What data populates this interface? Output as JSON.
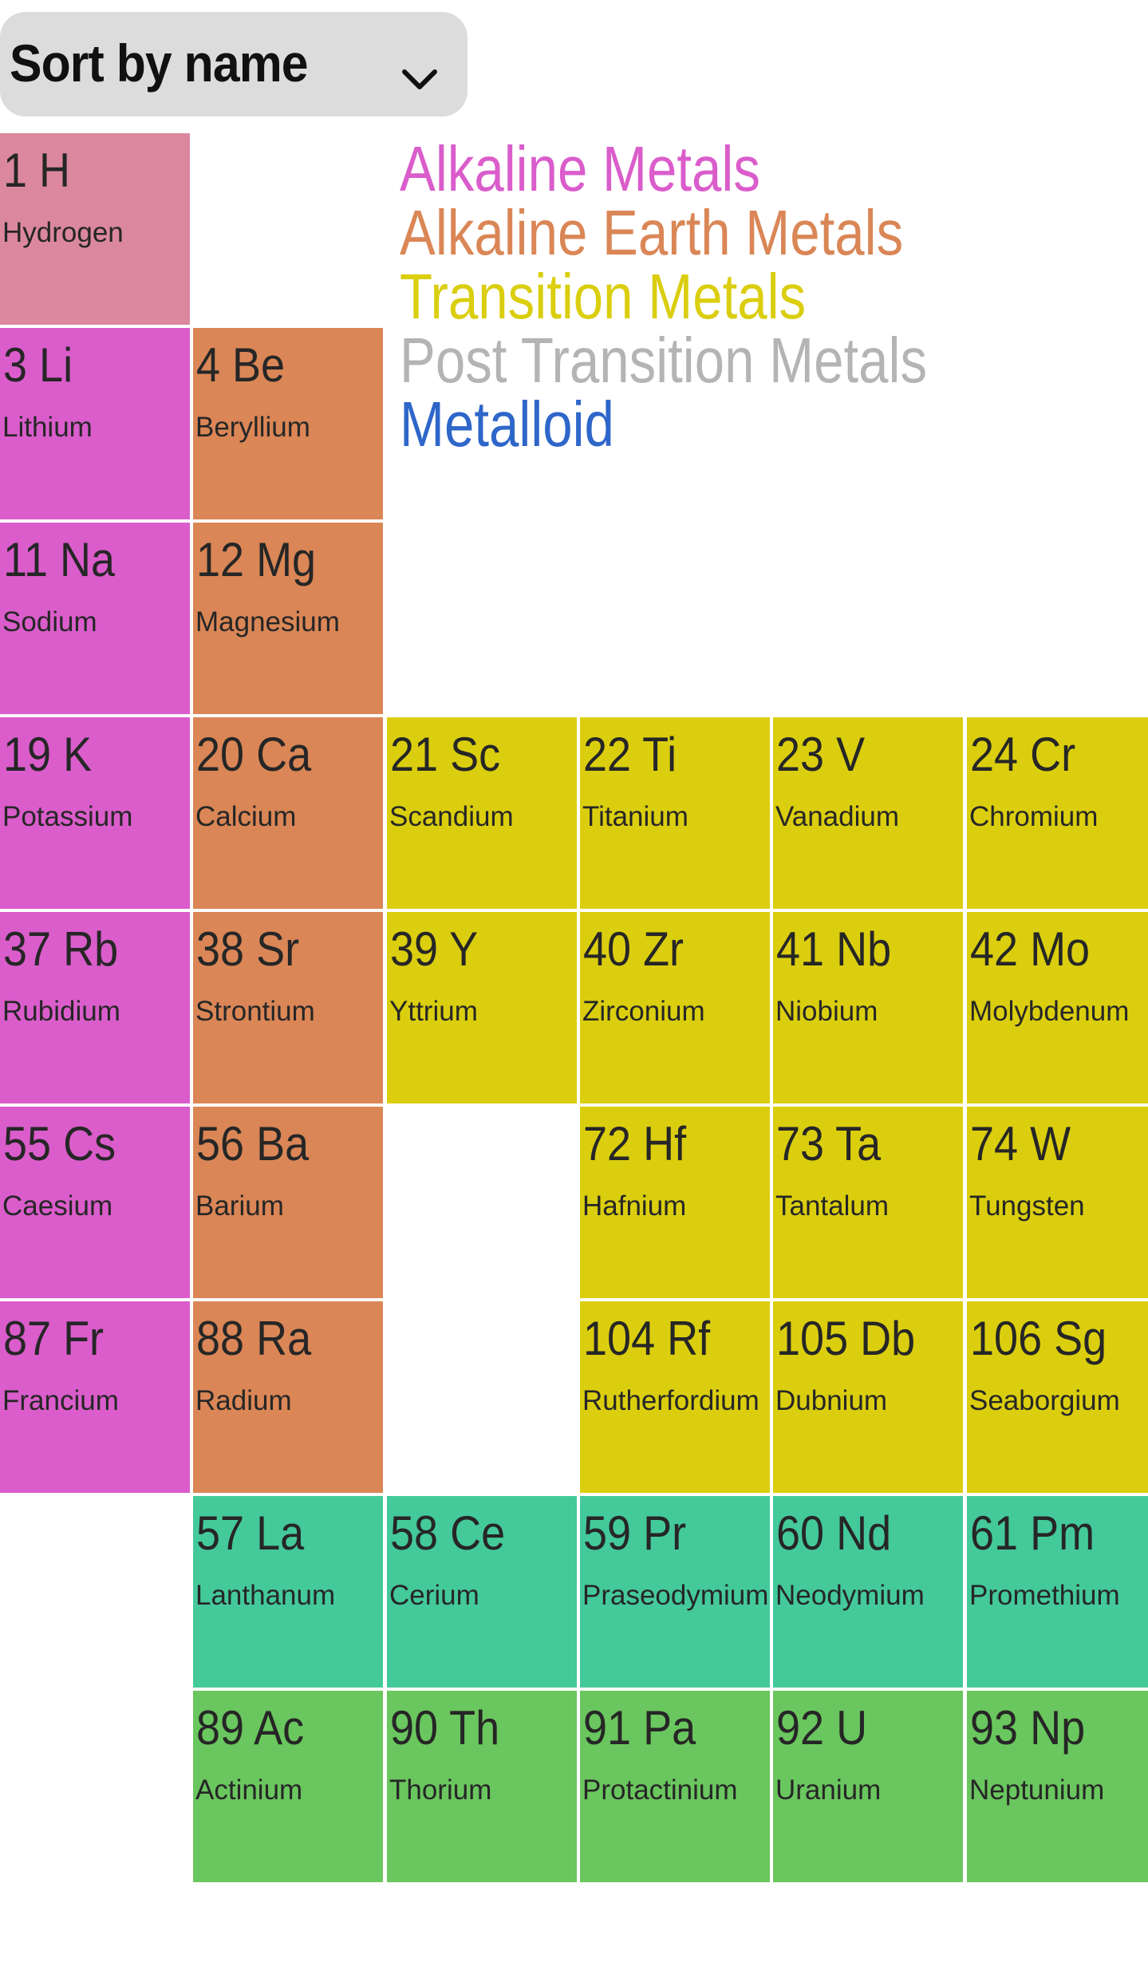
{
  "sort": {
    "label": "Sort by name",
    "icon": "chevron-down-icon"
  },
  "legend": [
    {
      "label": "Alkaline Metals",
      "color": "#DA5DCB"
    },
    {
      "label": "Alkaline Earth Metals",
      "color": "#DA8656"
    },
    {
      "label": "Transition Metals",
      "color": "#DACE0E"
    },
    {
      "label": "Post Transition Metals",
      "color": "#B4B4B4"
    },
    {
      "label": "Metalloid",
      "color": "#2E66C9"
    }
  ],
  "colors": {
    "hydrogen": "#DB889F",
    "alkali": "#DA5DCB",
    "alkaline_earth": "#DA8656",
    "transition": "#DBCE0E",
    "lanthanide": "#44C99A",
    "actinide": "#6AC65E"
  },
  "elements": [
    {
      "number": 1,
      "symbol": "H",
      "name": "Hydrogen",
      "category": "hydrogen",
      "row": 0,
      "col": 0
    },
    {
      "number": 3,
      "symbol": "Li",
      "name": "Lithium",
      "category": "alkali",
      "row": 1,
      "col": 0
    },
    {
      "number": 4,
      "symbol": "Be",
      "name": "Beryllium",
      "category": "alkaline_earth",
      "row": 1,
      "col": 1
    },
    {
      "number": 11,
      "symbol": "Na",
      "name": "Sodium",
      "category": "alkali",
      "row": 2,
      "col": 0
    },
    {
      "number": 12,
      "symbol": "Mg",
      "name": "Magnesium",
      "category": "alkaline_earth",
      "row": 2,
      "col": 1
    },
    {
      "number": 19,
      "symbol": "K",
      "name": "Potassium",
      "category": "alkali",
      "row": 3,
      "col": 0
    },
    {
      "number": 20,
      "symbol": "Ca",
      "name": "Calcium",
      "category": "alkaline_earth",
      "row": 3,
      "col": 1
    },
    {
      "number": 21,
      "symbol": "Sc",
      "name": "Scandium",
      "category": "transition",
      "row": 3,
      "col": 2
    },
    {
      "number": 22,
      "symbol": "Ti",
      "name": "Titanium",
      "category": "transition",
      "row": 3,
      "col": 3
    },
    {
      "number": 23,
      "symbol": "V",
      "name": "Vanadium",
      "category": "transition",
      "row": 3,
      "col": 4
    },
    {
      "number": 24,
      "symbol": "Cr",
      "name": "Chromium",
      "category": "transition",
      "row": 3,
      "col": 5
    },
    {
      "number": 37,
      "symbol": "Rb",
      "name": "Rubidium",
      "category": "alkali",
      "row": 4,
      "col": 0
    },
    {
      "number": 38,
      "symbol": "Sr",
      "name": "Strontium",
      "category": "alkaline_earth",
      "row": 4,
      "col": 1
    },
    {
      "number": 39,
      "symbol": "Y",
      "name": "Yttrium",
      "category": "transition",
      "row": 4,
      "col": 2
    },
    {
      "number": 40,
      "symbol": "Zr",
      "name": "Zirconium",
      "category": "transition",
      "row": 4,
      "col": 3
    },
    {
      "number": 41,
      "symbol": "Nb",
      "name": "Niobium",
      "category": "transition",
      "row": 4,
      "col": 4
    },
    {
      "number": 42,
      "symbol": "Mo",
      "name": "Molybdenum",
      "category": "transition",
      "row": 4,
      "col": 5
    },
    {
      "number": 55,
      "symbol": "Cs",
      "name": "Caesium",
      "category": "alkali",
      "row": 5,
      "col": 0
    },
    {
      "number": 56,
      "symbol": "Ba",
      "name": "Barium",
      "category": "alkaline_earth",
      "row": 5,
      "col": 1
    },
    {
      "number": 72,
      "symbol": "Hf",
      "name": "Hafnium",
      "category": "transition",
      "row": 5,
      "col": 3
    },
    {
      "number": 73,
      "symbol": "Ta",
      "name": "Tantalum",
      "category": "transition",
      "row": 5,
      "col": 4
    },
    {
      "number": 74,
      "symbol": "W",
      "name": "Tungsten",
      "category": "transition",
      "row": 5,
      "col": 5
    },
    {
      "number": 87,
      "symbol": "Fr",
      "name": "Francium",
      "category": "alkali",
      "row": 6,
      "col": 0
    },
    {
      "number": 88,
      "symbol": "Ra",
      "name": "Radium",
      "category": "alkaline_earth",
      "row": 6,
      "col": 1
    },
    {
      "number": 104,
      "symbol": "Rf",
      "name": "Rutherfordium",
      "category": "transition",
      "row": 6,
      "col": 3
    },
    {
      "number": 105,
      "symbol": "Db",
      "name": "Dubnium",
      "category": "transition",
      "row": 6,
      "col": 4
    },
    {
      "number": 106,
      "symbol": "Sg",
      "name": "Seaborgium",
      "category": "transition",
      "row": 6,
      "col": 5
    },
    {
      "number": 57,
      "symbol": "La",
      "name": "Lanthanum",
      "category": "lanthanide",
      "row": 7,
      "col": 1
    },
    {
      "number": 58,
      "symbol": "Ce",
      "name": "Cerium",
      "category": "lanthanide",
      "row": 7,
      "col": 2
    },
    {
      "number": 59,
      "symbol": "Pr",
      "name": "Praseodymium",
      "category": "lanthanide",
      "row": 7,
      "col": 3
    },
    {
      "number": 60,
      "symbol": "Nd",
      "name": "Neodymium",
      "category": "lanthanide",
      "row": 7,
      "col": 4
    },
    {
      "number": 61,
      "symbol": "Pm",
      "name": "Promethium",
      "category": "lanthanide",
      "row": 7,
      "col": 5
    },
    {
      "number": 89,
      "symbol": "Ac",
      "name": "Actinium",
      "category": "actinide",
      "row": 8,
      "col": 1
    },
    {
      "number": 90,
      "symbol": "Th",
      "name": "Thorium",
      "category": "actinide",
      "row": 8,
      "col": 2
    },
    {
      "number": 91,
      "symbol": "Pa",
      "name": "Protactinium",
      "category": "actinide",
      "row": 8,
      "col": 3
    },
    {
      "number": 92,
      "symbol": "U",
      "name": "Uranium",
      "category": "actinide",
      "row": 8,
      "col": 4
    },
    {
      "number": 93,
      "symbol": "Np",
      "name": "Neptunium",
      "category": "actinide",
      "row": 8,
      "col": 5
    }
  ]
}
